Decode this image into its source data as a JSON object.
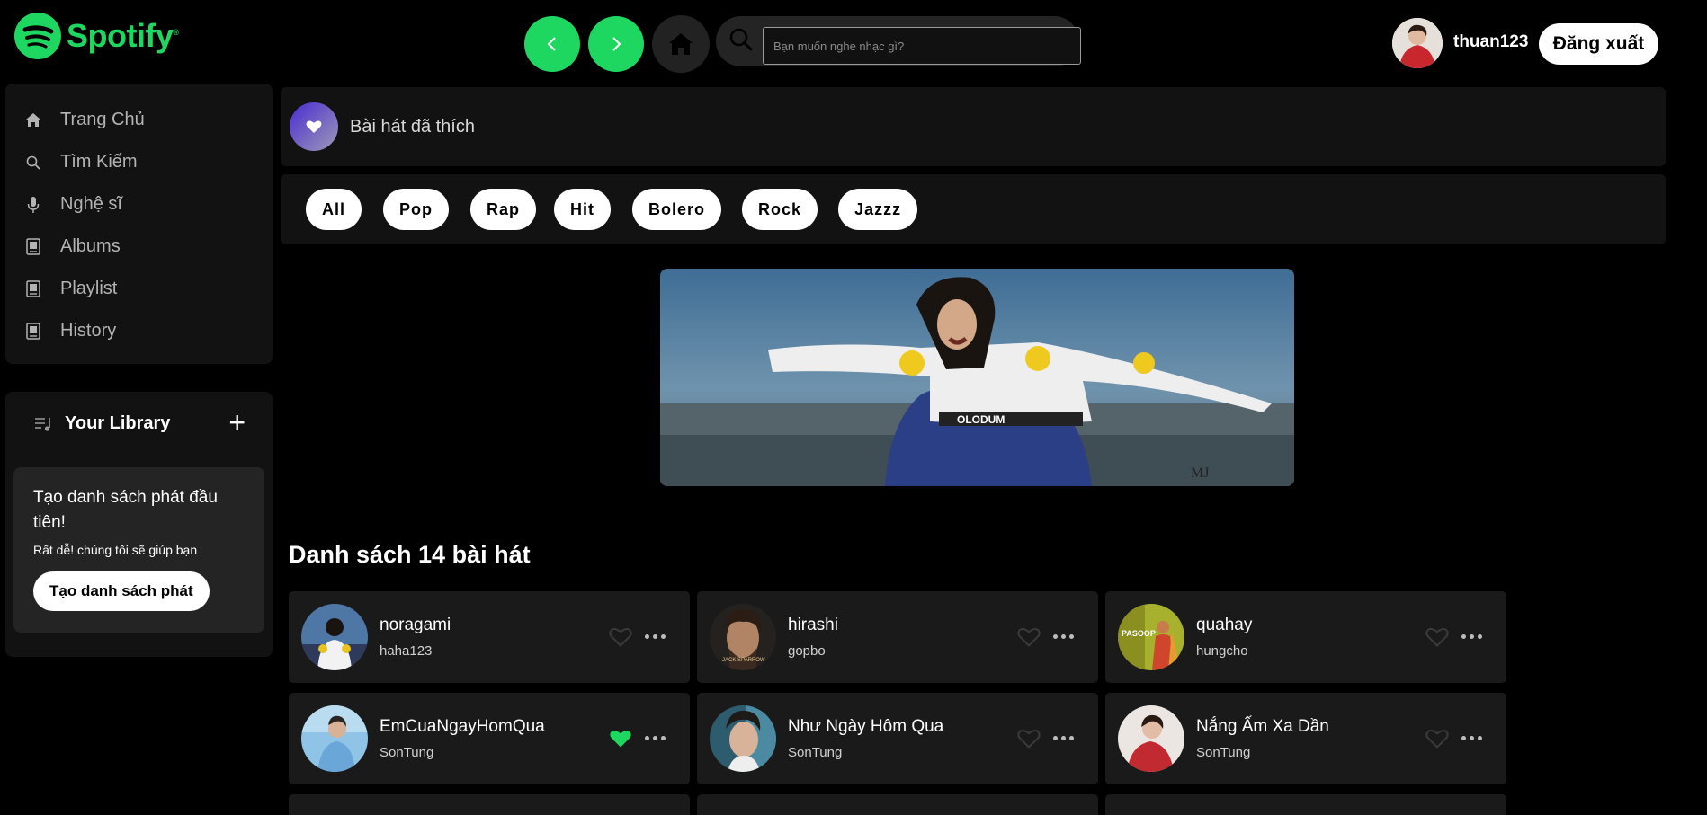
{
  "header": {
    "brand": "Spotify",
    "brand_mark": "®",
    "search_placeholder": "Bạn muốn nghe nhạc gì?",
    "username": "thuan123",
    "logout_label": "Đăng xuất",
    "accent_color": "#1ed760"
  },
  "sidebar": {
    "items": [
      {
        "label": "Trang Chủ",
        "icon": "home-icon"
      },
      {
        "label": "Tìm Kiếm",
        "icon": "search-icon"
      },
      {
        "label": "Nghệ sĩ",
        "icon": "microphone-icon"
      },
      {
        "label": "Albums",
        "icon": "album-icon"
      },
      {
        "label": "Playlist",
        "icon": "playlist-icon"
      },
      {
        "label": "History",
        "icon": "history-icon"
      }
    ]
  },
  "library": {
    "title": "Your Library",
    "card_title": "Tạo danh sách phát đầu tiên!",
    "card_text": "Rất dễ! chúng tôi sẽ giúp bạn",
    "create_label": "Tạo danh sách phát"
  },
  "main": {
    "liked_label": "Bài hát đã thích",
    "genres": [
      "All",
      "Pop",
      "Rap",
      "Hit",
      "Bolero",
      "Rock",
      "Jazzz"
    ],
    "section_title": "Danh sách 14 bài hát",
    "songs": [
      {
        "name": "noragami",
        "artist": "haha123",
        "liked": false
      },
      {
        "name": "hirashi",
        "artist": "gopbo",
        "liked": false
      },
      {
        "name": "quahay",
        "artist": "hungcho",
        "liked": false
      },
      {
        "name": "EmCuaNgayHomQua",
        "artist": "SonTung",
        "liked": true
      },
      {
        "name": "Như Ngày Hôm Qua",
        "artist": "SonTung",
        "liked": false
      },
      {
        "name": "Nắng Ấm Xa Dần",
        "artist": "SonTung",
        "liked": false
      }
    ]
  }
}
